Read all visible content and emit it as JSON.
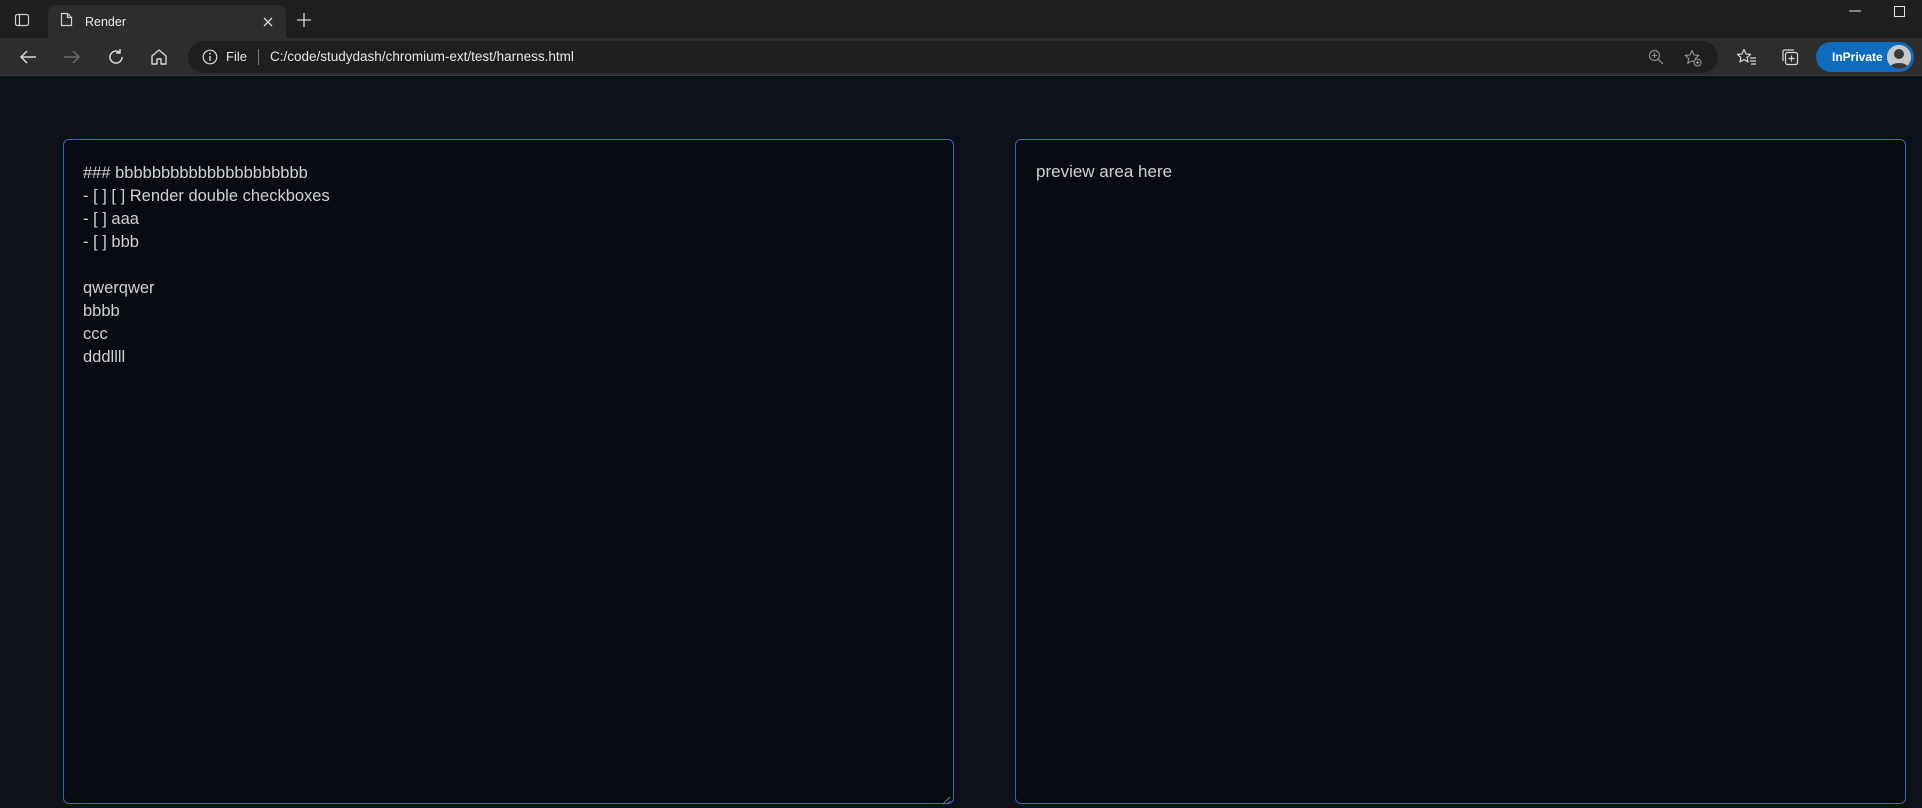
{
  "browser": {
    "tab": {
      "title": "Render"
    },
    "omnibox": {
      "scheme_label": "File",
      "url": "C:/code/studydash/chromium-ext/test/harness.html"
    },
    "inprivate_label": "InPrivate"
  },
  "editor": {
    "content": "### bbbbbbbbbbbbbbbbbbbbb\n- [ ] [ ] Render double checkboxes\n- [ ] aaa\n- [ ] bbb\n\nqwerqwer\nbbbb\nccc\ndddllll"
  },
  "preview": {
    "text": "preview area here"
  },
  "colors": {
    "page_background": "#0d111a",
    "pane_border": "#3566c8",
    "inprivate_badge": "#0f6cbd"
  },
  "icons": [
    "tab-actions-icon",
    "page-icon",
    "close-icon",
    "plus-icon",
    "minimize-icon",
    "maximize-icon",
    "back-icon",
    "forward-icon",
    "refresh-icon",
    "home-icon",
    "info-icon",
    "zoom-icon",
    "favorite-add-icon",
    "favorites-icon",
    "collections-icon"
  ]
}
